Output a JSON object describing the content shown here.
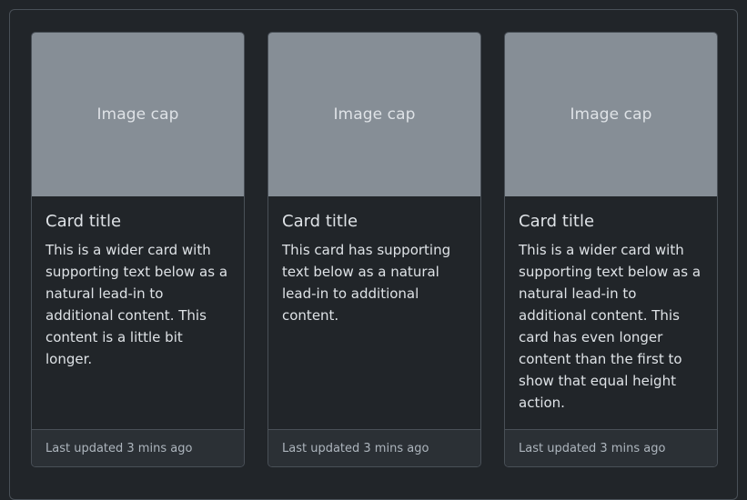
{
  "cards": [
    {
      "image_label": "Image cap",
      "title": "Card title",
      "text": "This is a wider card with supporting text below as a natural lead-in to additional content. This content is a little bit longer.",
      "footer": "Last updated 3 mins ago"
    },
    {
      "image_label": "Image cap",
      "title": "Card title",
      "text": "This card has supporting text below as a natural lead-in to additional content.",
      "footer": "Last updated 3 mins ago"
    },
    {
      "image_label": "Image cap",
      "title": "Card title",
      "text": "This is a wider card with supporting text below as a natural lead-in to additional content. This card has even longer content than the first to show that equal height action.",
      "footer": "Last updated 3 mins ago"
    }
  ],
  "colors": {
    "background": "#212529",
    "image_placeholder": "#868e96",
    "border": "#495057",
    "footer_bg": "#2b3035"
  }
}
